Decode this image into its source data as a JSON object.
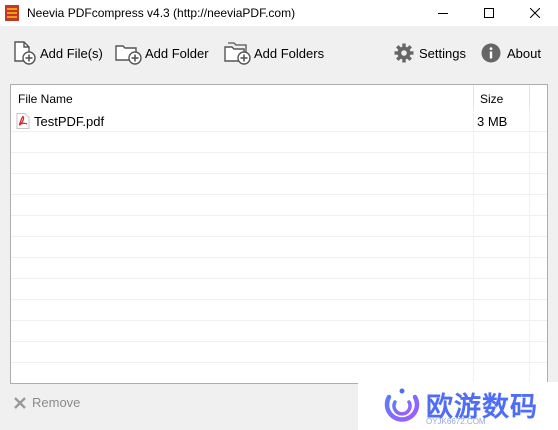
{
  "window": {
    "title": "Neevia PDFcompress v4.3 (http://neeviaPDF.com)",
    "controls": [
      "minimize",
      "maximize",
      "close"
    ]
  },
  "toolbar": {
    "add_files": "Add File(s)",
    "add_folder": "Add Folder",
    "add_folders": "Add Folders",
    "settings": "Settings",
    "about": "About"
  },
  "file_list": {
    "columns": [
      "File Name",
      "Size"
    ],
    "rows": [
      {
        "name": "TestPDF.pdf",
        "size": "3 MB",
        "icon": "pdf-file-icon"
      }
    ]
  },
  "footer": {
    "remove": "Remove"
  },
  "watermark": {
    "text": "欧游数码",
    "subtext": "OYJK6672.COM"
  },
  "colors": {
    "title_bar": "#ffffff",
    "window_bg": "#f0f0f0",
    "pdf_red": "#d22b2b",
    "watermark_blue": "#4f6ef7"
  }
}
